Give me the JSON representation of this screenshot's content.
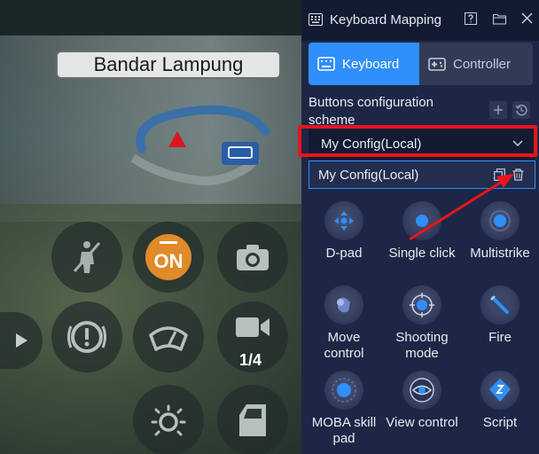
{
  "window": {
    "title": "Keyboard Mapping"
  },
  "tabs": [
    {
      "label": "Keyboard",
      "active": true
    },
    {
      "label": "Controller",
      "active": false
    }
  ],
  "scheme": {
    "label": "Buttons configuration scheme",
    "selected": "My Config(Local)",
    "options": [
      "My Config(Local)"
    ]
  },
  "tools": [
    {
      "label": "D-pad",
      "icon": "dpad-icon"
    },
    {
      "label": "Single click",
      "icon": "single-click-icon"
    },
    {
      "label": "Multistrike",
      "icon": "multistrike-icon"
    },
    {
      "label": "Move control",
      "icon": "move-control-icon"
    },
    {
      "label": "Shooting mode",
      "icon": "shooting-mode-icon"
    },
    {
      "label": "Fire",
      "icon": "fire-icon"
    },
    {
      "label": "MOBA skill pad",
      "icon": "moba-skill-pad-icon"
    },
    {
      "label": "View control",
      "icon": "view-control-icon"
    },
    {
      "label": "Script",
      "icon": "script-icon"
    }
  ],
  "game": {
    "location": "Bandar Lampung",
    "engine_label": "ON",
    "camera_label": "1/4"
  },
  "colors": {
    "accent": "#2f8ffb",
    "panel_bg": "#1d2745",
    "titlebar_bg": "#131b33",
    "highlight_red": "#e8151c"
  }
}
